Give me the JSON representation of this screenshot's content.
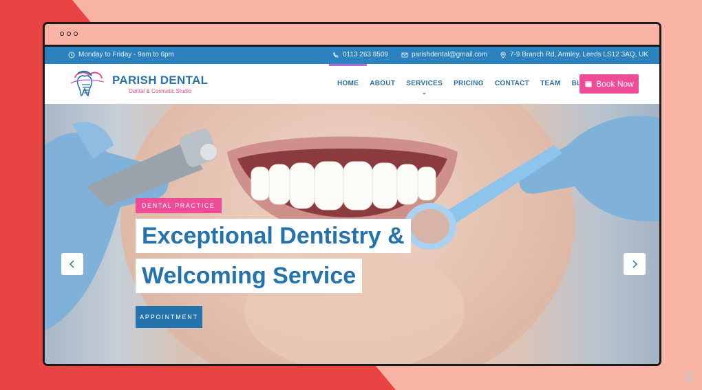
{
  "page_number": "2",
  "topbar": {
    "hours": "Monday to Friday - 9am to 6pm",
    "phone": "0113 263 8509",
    "email": "parishdental@gmail.com",
    "address": "7-9 Branch Rd, Armley, Leeds LS12 3AQ, UK"
  },
  "brand": {
    "name": "PARISH DENTAL",
    "tagline": "Dental & Cosmetic Studio"
  },
  "nav": {
    "items": [
      "HOME",
      "ABOUT",
      "SERVICES",
      "PRICING",
      "CONTACT",
      "TEAM",
      "BLOGS"
    ],
    "active": "HOME"
  },
  "book_button": "Book Now",
  "hero": {
    "tag": "DENTAL PRACTICE",
    "headline_line1": "Exceptional Dentistry &",
    "headline_line2": "Welcoming Service",
    "cta": "APPOINTMENT"
  },
  "colors": {
    "topbar": "#2c82bf",
    "brand_blue": "#2473ad",
    "accent_pink": "#ee4c97",
    "slide_bg_red": "#e84444",
    "slide_bg_peach": "#f9b3a4"
  },
  "icons": {
    "hours": "clock-icon",
    "phone": "phone-icon",
    "email": "mail-icon",
    "address": "location-pin-icon",
    "book": "calendar-icon",
    "prev": "chevron-left-icon",
    "next": "chevron-right-icon"
  }
}
